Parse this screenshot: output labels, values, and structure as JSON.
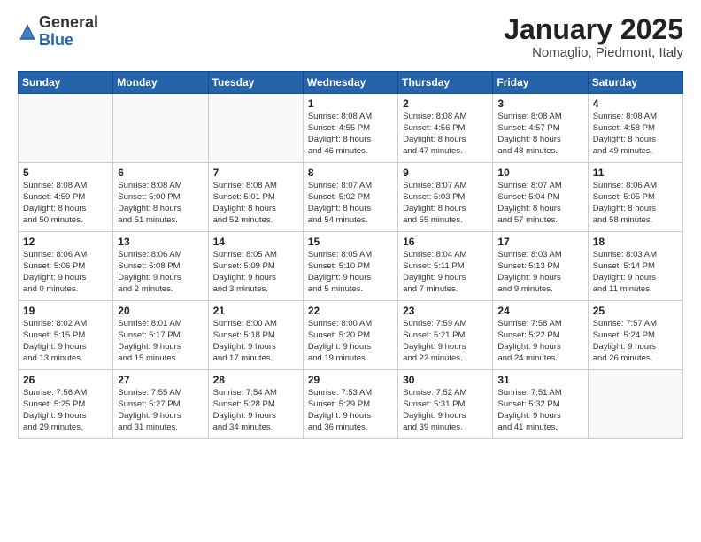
{
  "header": {
    "logo": {
      "general": "General",
      "blue": "Blue"
    },
    "title": "January 2025",
    "location": "Nomaglio, Piedmont, Italy"
  },
  "weekdays": [
    "Sunday",
    "Monday",
    "Tuesday",
    "Wednesday",
    "Thursday",
    "Friday",
    "Saturday"
  ],
  "weeks": [
    [
      {
        "day": "",
        "info": ""
      },
      {
        "day": "",
        "info": ""
      },
      {
        "day": "",
        "info": ""
      },
      {
        "day": "1",
        "info": "Sunrise: 8:08 AM\nSunset: 4:55 PM\nDaylight: 8 hours\nand 46 minutes."
      },
      {
        "day": "2",
        "info": "Sunrise: 8:08 AM\nSunset: 4:56 PM\nDaylight: 8 hours\nand 47 minutes."
      },
      {
        "day": "3",
        "info": "Sunrise: 8:08 AM\nSunset: 4:57 PM\nDaylight: 8 hours\nand 48 minutes."
      },
      {
        "day": "4",
        "info": "Sunrise: 8:08 AM\nSunset: 4:58 PM\nDaylight: 8 hours\nand 49 minutes."
      }
    ],
    [
      {
        "day": "5",
        "info": "Sunrise: 8:08 AM\nSunset: 4:59 PM\nDaylight: 8 hours\nand 50 minutes."
      },
      {
        "day": "6",
        "info": "Sunrise: 8:08 AM\nSunset: 5:00 PM\nDaylight: 8 hours\nand 51 minutes."
      },
      {
        "day": "7",
        "info": "Sunrise: 8:08 AM\nSunset: 5:01 PM\nDaylight: 8 hours\nand 52 minutes."
      },
      {
        "day": "8",
        "info": "Sunrise: 8:07 AM\nSunset: 5:02 PM\nDaylight: 8 hours\nand 54 minutes."
      },
      {
        "day": "9",
        "info": "Sunrise: 8:07 AM\nSunset: 5:03 PM\nDaylight: 8 hours\nand 55 minutes."
      },
      {
        "day": "10",
        "info": "Sunrise: 8:07 AM\nSunset: 5:04 PM\nDaylight: 8 hours\nand 57 minutes."
      },
      {
        "day": "11",
        "info": "Sunrise: 8:06 AM\nSunset: 5:05 PM\nDaylight: 8 hours\nand 58 minutes."
      }
    ],
    [
      {
        "day": "12",
        "info": "Sunrise: 8:06 AM\nSunset: 5:06 PM\nDaylight: 9 hours\nand 0 minutes."
      },
      {
        "day": "13",
        "info": "Sunrise: 8:06 AM\nSunset: 5:08 PM\nDaylight: 9 hours\nand 2 minutes."
      },
      {
        "day": "14",
        "info": "Sunrise: 8:05 AM\nSunset: 5:09 PM\nDaylight: 9 hours\nand 3 minutes."
      },
      {
        "day": "15",
        "info": "Sunrise: 8:05 AM\nSunset: 5:10 PM\nDaylight: 9 hours\nand 5 minutes."
      },
      {
        "day": "16",
        "info": "Sunrise: 8:04 AM\nSunset: 5:11 PM\nDaylight: 9 hours\nand 7 minutes."
      },
      {
        "day": "17",
        "info": "Sunrise: 8:03 AM\nSunset: 5:13 PM\nDaylight: 9 hours\nand 9 minutes."
      },
      {
        "day": "18",
        "info": "Sunrise: 8:03 AM\nSunset: 5:14 PM\nDaylight: 9 hours\nand 11 minutes."
      }
    ],
    [
      {
        "day": "19",
        "info": "Sunrise: 8:02 AM\nSunset: 5:15 PM\nDaylight: 9 hours\nand 13 minutes."
      },
      {
        "day": "20",
        "info": "Sunrise: 8:01 AM\nSunset: 5:17 PM\nDaylight: 9 hours\nand 15 minutes."
      },
      {
        "day": "21",
        "info": "Sunrise: 8:00 AM\nSunset: 5:18 PM\nDaylight: 9 hours\nand 17 minutes."
      },
      {
        "day": "22",
        "info": "Sunrise: 8:00 AM\nSunset: 5:20 PM\nDaylight: 9 hours\nand 19 minutes."
      },
      {
        "day": "23",
        "info": "Sunrise: 7:59 AM\nSunset: 5:21 PM\nDaylight: 9 hours\nand 22 minutes."
      },
      {
        "day": "24",
        "info": "Sunrise: 7:58 AM\nSunset: 5:22 PM\nDaylight: 9 hours\nand 24 minutes."
      },
      {
        "day": "25",
        "info": "Sunrise: 7:57 AM\nSunset: 5:24 PM\nDaylight: 9 hours\nand 26 minutes."
      }
    ],
    [
      {
        "day": "26",
        "info": "Sunrise: 7:56 AM\nSunset: 5:25 PM\nDaylight: 9 hours\nand 29 minutes."
      },
      {
        "day": "27",
        "info": "Sunrise: 7:55 AM\nSunset: 5:27 PM\nDaylight: 9 hours\nand 31 minutes."
      },
      {
        "day": "28",
        "info": "Sunrise: 7:54 AM\nSunset: 5:28 PM\nDaylight: 9 hours\nand 34 minutes."
      },
      {
        "day": "29",
        "info": "Sunrise: 7:53 AM\nSunset: 5:29 PM\nDaylight: 9 hours\nand 36 minutes."
      },
      {
        "day": "30",
        "info": "Sunrise: 7:52 AM\nSunset: 5:31 PM\nDaylight: 9 hours\nand 39 minutes."
      },
      {
        "day": "31",
        "info": "Sunrise: 7:51 AM\nSunset: 5:32 PM\nDaylight: 9 hours\nand 41 minutes."
      },
      {
        "day": "",
        "info": ""
      }
    ]
  ]
}
